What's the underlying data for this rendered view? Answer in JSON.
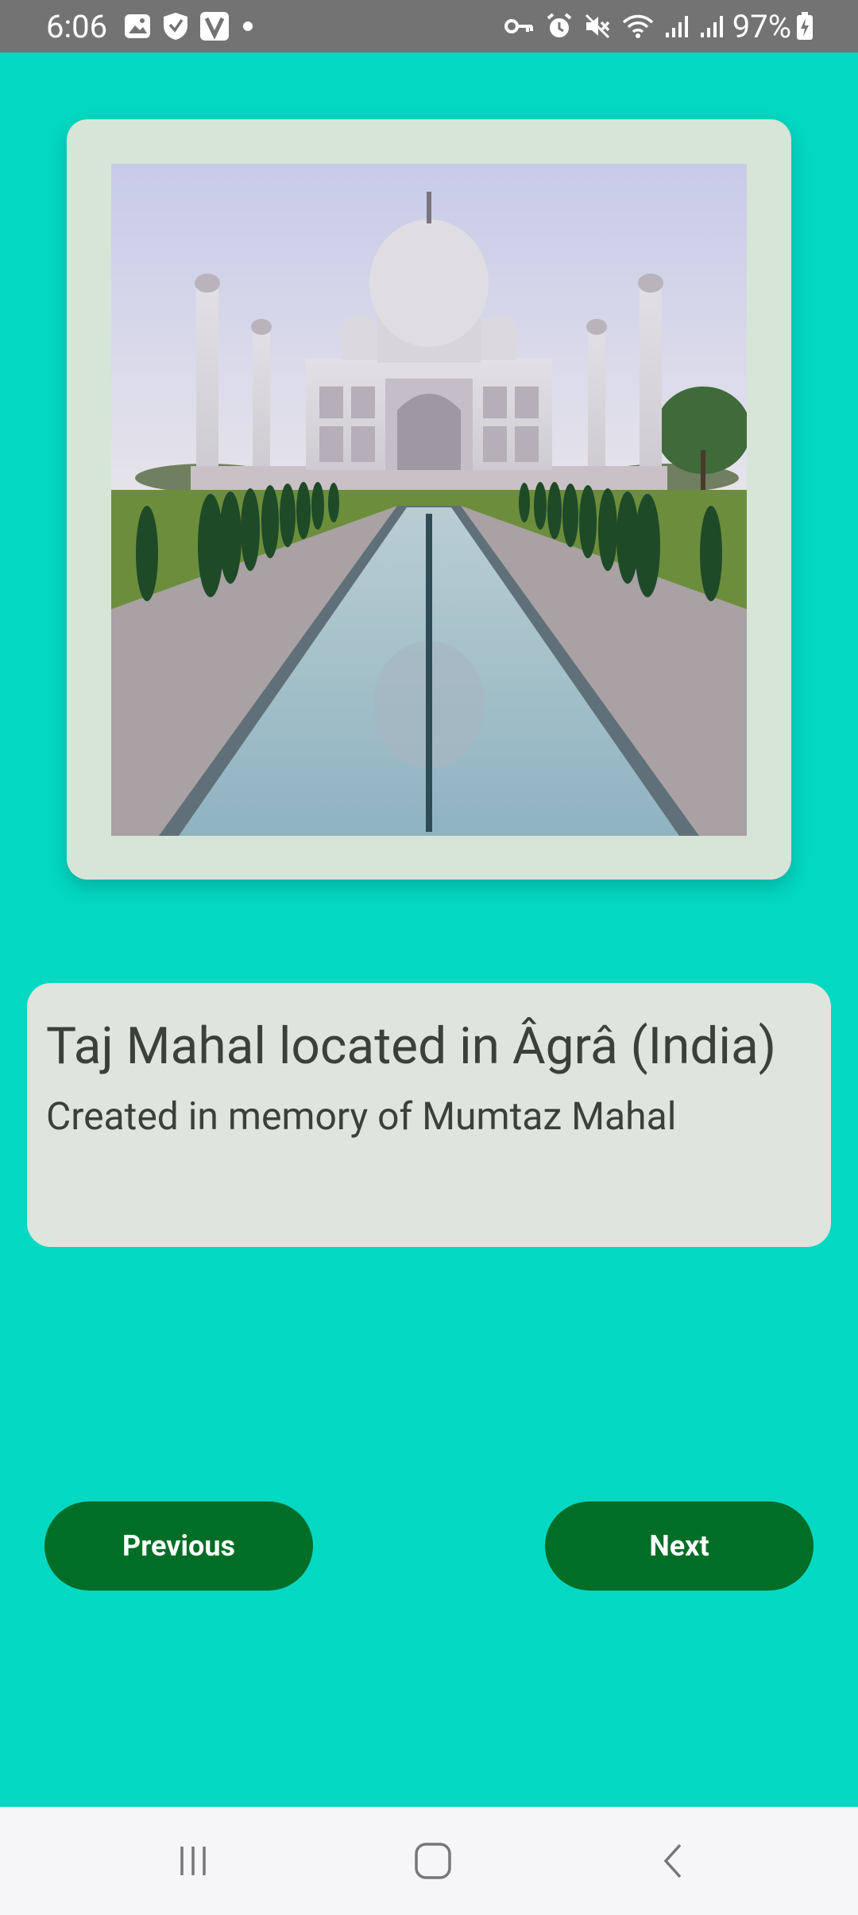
{
  "status_bar": {
    "time": "6:06",
    "battery_percent": "97%",
    "icons_left": [
      "image-icon",
      "shield-icon",
      "v-app-icon",
      "dot-icon"
    ],
    "icons_right": [
      "key-icon",
      "alarm-icon",
      "mute-icon",
      "wifi-icon",
      "signal-icon",
      "signal-icon",
      "battery-charging-icon"
    ]
  },
  "landmark": {
    "title": "Taj Mahal located in Âgrâ (India)",
    "subtitle": "Created in memory of Mumtaz Mahal"
  },
  "buttons": {
    "previous_label": "Previous",
    "next_label": "Next"
  },
  "nav": {
    "icons": [
      "recent-apps-icon",
      "home-icon",
      "back-icon"
    ]
  },
  "colors": {
    "background": "#03d8c2",
    "card": "#d6e5d7",
    "info_card": "#dfe5dc",
    "button": "#006e27"
  }
}
